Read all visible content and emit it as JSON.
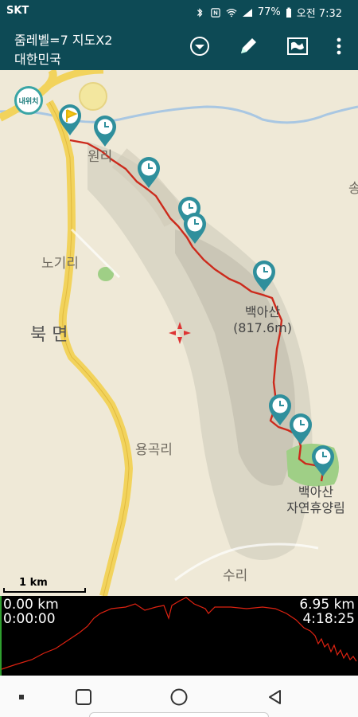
{
  "status_bar": {
    "carrier": "SKT",
    "battery": "77%",
    "time": "오전 7:32"
  },
  "app_bar": {
    "line1": "줌레벨=7 지도X2",
    "line2": "대한민국",
    "icons": [
      "dropdown-icon",
      "pencil-icon",
      "map-icon",
      "more-vert-icon"
    ]
  },
  "map": {
    "locate_label": "내위치",
    "labels": {
      "village1": "원리",
      "village2": "노기리",
      "district": "북 면",
      "village3": "용곡리",
      "village4": "수리",
      "partial": "송"
    },
    "peak_name": "백아산",
    "peak_elev": "(817.6m)",
    "forest_name": "백아산",
    "forest_sub": "자연휴양림",
    "scale": "1 km"
  },
  "elevation": {
    "dist_start": "0.00 km",
    "time_start": "0:00:00",
    "dist_end": "6.95 km",
    "time_end": "4:18:25"
  },
  "colors": {
    "bar": "#0d4a55",
    "track": "#cc2a1c",
    "marker": "#2f8f9c",
    "road": "#f2d35c"
  }
}
